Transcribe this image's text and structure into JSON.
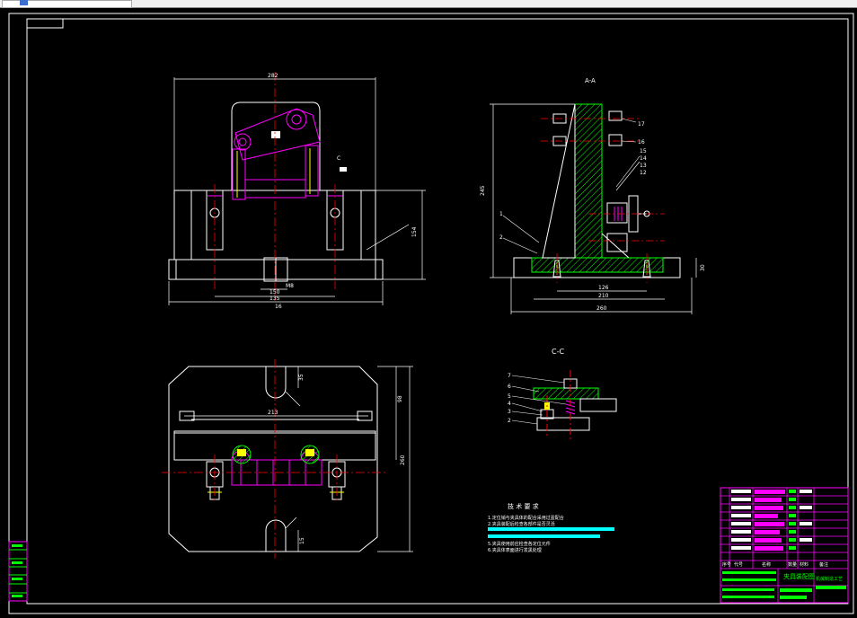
{
  "drawing": {
    "section_label": "C-C",
    "view_label_aa": "A-A",
    "tech_requirements": {
      "title": "技 术 要 求",
      "lines": [
        "1.定位销与夹具体的配合采用过盈配合",
        "2.夹具装配后检查各部件是否灵活",
        "3.",
        "4.",
        "5.夹具使用前应检查各定位元件",
        "6.夹具体表面进行发黑处理"
      ]
    },
    "dims": {
      "front_width": "282",
      "front_base_1": "150",
      "front_base_2": "135",
      "front_height": "154",
      "front_bolt": "M8",
      "front_small": "16",
      "side_height": "245",
      "side_w1": "126",
      "side_w2": "210",
      "side_w3": "260",
      "side_base": "30",
      "top_span": "213",
      "top_h1": "98",
      "top_h2": "35",
      "top_h3": "260",
      "top_slot": "15"
    },
    "balloons": [
      "17",
      "16",
      "15",
      "14",
      "13",
      "12",
      "1",
      "2",
      "3",
      "4",
      "5",
      "6",
      "7",
      "8"
    ],
    "cc_balloons": [
      "7",
      "6",
      "5",
      "4",
      "3",
      "2",
      "1"
    ],
    "title_block": {
      "drawing_name": "夹具装配图",
      "school": "机械制造工艺",
      "row_headers": [
        "序号",
        "代号",
        "名称",
        "数量",
        "材料",
        "备注"
      ]
    }
  },
  "colors": {
    "background": "#000000",
    "outline": "#ffffff",
    "part": "#ff00ff",
    "centerline": "#ff0000",
    "dimension": "#00ff00",
    "hatch": "#00ff00",
    "highlight": "#00ffff",
    "yellow": "#ffff00"
  }
}
